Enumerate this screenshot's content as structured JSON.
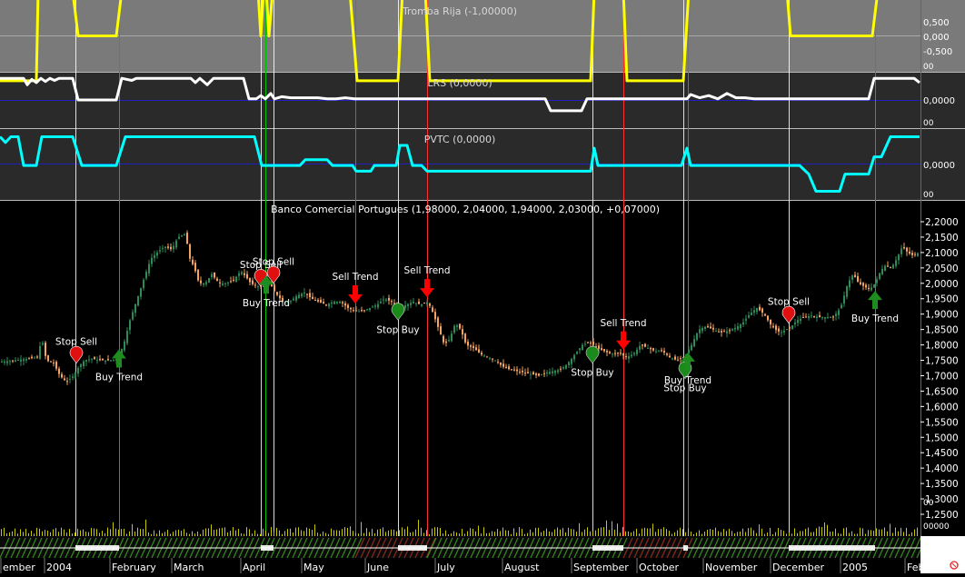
{
  "panels": {
    "tromba": {
      "title": "Tromba Rija (-1,00000)",
      "ticks": [
        "0,500",
        "0,000",
        "-0,500"
      ],
      "corner": "00"
    },
    "lrs": {
      "title": "LRS (0,0000)",
      "ticks": [
        "0,0000"
      ],
      "corner": "00"
    },
    "pvtc": {
      "title": "PVTC (0,0000)",
      "ticks": [
        "0,0000"
      ],
      "corner": "00"
    },
    "price": {
      "title": "Banco Comercial Portugues (1,98000, 2,04000, 1,94000, 2,03000, +0,07000)",
      "corner1": "00",
      "corner2": "00000"
    }
  },
  "colors": {
    "tromba_line": "#ffff00",
    "lrs_line": "#ffffff",
    "pvtc_line": "#00ffff",
    "candle_up": "#2e8b57",
    "candle_down": "#f4a460",
    "buy_arrow": "#1e8c1e",
    "sell_arrow": "#ff0000",
    "buy_line": "#00c000",
    "sell_line": "#ff3030",
    "stop_line": "#ffffff"
  },
  "chart_data": {
    "type": "line",
    "y_axis_ticks": [
      "2,2000",
      "2,1500",
      "2,1000",
      "2,0500",
      "2,0000",
      "1,9500",
      "1,9000",
      "1,8500",
      "1,8000",
      "1,7500",
      "1,7000",
      "1,6500",
      "1,6000",
      "1,5500",
      "1,5000",
      "1,4500",
      "1,4000",
      "1,3500",
      "1,3000",
      "1,2500"
    ],
    "ylim": [
      1.22,
      2.23
    ],
    "x_axis_labels": [
      "ember",
      "2004",
      "February",
      "March",
      "April",
      "May",
      "June",
      "July",
      "August",
      "September",
      "October",
      "November",
      "December",
      "2005",
      "Feb"
    ],
    "price_series": [
      [
        0,
        1.745
      ],
      [
        10,
        1.748
      ],
      [
        20,
        1.752
      ],
      [
        30,
        1.755
      ],
      [
        40,
        1.76
      ],
      [
        45,
        1.82
      ],
      [
        50,
        1.75
      ],
      [
        58,
        1.74
      ],
      [
        65,
        1.7
      ],
      [
        72,
        1.68
      ],
      [
        80,
        1.7
      ],
      [
        86,
        1.73
      ],
      [
        92,
        1.75
      ],
      [
        100,
        1.755
      ],
      [
        110,
        1.75
      ],
      [
        120,
        1.75
      ],
      [
        128,
        1.755
      ],
      [
        135,
        1.8
      ],
      [
        142,
        1.88
      ],
      [
        150,
        1.95
      ],
      [
        158,
        2.02
      ],
      [
        165,
        2.08
      ],
      [
        172,
        2.1
      ],
      [
        180,
        2.12
      ],
      [
        188,
        2.11
      ],
      [
        195,
        2.15
      ],
      [
        203,
        2.16
      ],
      [
        208,
        2.08
      ],
      [
        213,
        2.05
      ],
      [
        218,
        2.0
      ],
      [
        225,
        2.0
      ],
      [
        232,
        2.03
      ],
      [
        240,
        2.0
      ],
      [
        248,
        2.0
      ],
      [
        256,
        2.01
      ],
      [
        264,
        2.04
      ],
      [
        270,
        2.02
      ],
      [
        275,
        2.0
      ],
      [
        282,
        1.99
      ],
      [
        290,
        1.99
      ],
      [
        296,
        2.0
      ],
      [
        302,
        1.97
      ],
      [
        310,
        1.94
      ],
      [
        318,
        1.94
      ],
      [
        326,
        1.96
      ],
      [
        334,
        1.97
      ],
      [
        342,
        1.95
      ],
      [
        350,
        1.94
      ],
      [
        358,
        1.93
      ],
      [
        366,
        1.94
      ],
      [
        374,
        1.94
      ],
      [
        382,
        1.92
      ],
      [
        390,
        1.91
      ],
      [
        398,
        1.91
      ],
      [
        406,
        1.92
      ],
      [
        414,
        1.93
      ],
      [
        422,
        1.95
      ],
      [
        430,
        1.94
      ],
      [
        438,
        1.92
      ],
      [
        446,
        1.93
      ],
      [
        454,
        1.94
      ],
      [
        462,
        1.93
      ],
      [
        470,
        1.94
      ],
      [
        476,
        1.9
      ],
      [
        482,
        1.85
      ],
      [
        488,
        1.8
      ],
      [
        494,
        1.82
      ],
      [
        500,
        1.87
      ],
      [
        506,
        1.85
      ],
      [
        512,
        1.8
      ],
      [
        520,
        1.79
      ],
      [
        528,
        1.77
      ],
      [
        536,
        1.76
      ],
      [
        544,
        1.75
      ],
      [
        552,
        1.73
      ],
      [
        560,
        1.72
      ],
      [
        568,
        1.715
      ],
      [
        576,
        1.71
      ],
      [
        584,
        1.705
      ],
      [
        592,
        1.7
      ],
      [
        600,
        1.71
      ],
      [
        608,
        1.715
      ],
      [
        616,
        1.72
      ],
      [
        624,
        1.74
      ],
      [
        632,
        1.77
      ],
      [
        640,
        1.8
      ],
      [
        648,
        1.81
      ],
      [
        656,
        1.79
      ],
      [
        664,
        1.78
      ],
      [
        672,
        1.77
      ],
      [
        680,
        1.775
      ],
      [
        688,
        1.76
      ],
      [
        696,
        1.77
      ],
      [
        704,
        1.8
      ],
      [
        712,
        1.79
      ],
      [
        720,
        1.78
      ],
      [
        728,
        1.78
      ],
      [
        736,
        1.76
      ],
      [
        744,
        1.75
      ],
      [
        752,
        1.76
      ],
      [
        760,
        1.8
      ],
      [
        768,
        1.85
      ],
      [
        776,
        1.86
      ],
      [
        784,
        1.85
      ],
      [
        792,
        1.84
      ],
      [
        800,
        1.845
      ],
      [
        808,
        1.855
      ],
      [
        816,
        1.87
      ],
      [
        824,
        1.9
      ],
      [
        832,
        1.92
      ],
      [
        840,
        1.9
      ],
      [
        846,
        1.87
      ],
      [
        852,
        1.85
      ],
      [
        858,
        1.84
      ],
      [
        864,
        1.85
      ],
      [
        870,
        1.86
      ],
      [
        876,
        1.88
      ],
      [
        884,
        1.89
      ],
      [
        892,
        1.895
      ],
      [
        900,
        1.89
      ],
      [
        908,
        1.89
      ],
      [
        916,
        1.89
      ],
      [
        924,
        1.92
      ],
      [
        932,
        2.0
      ],
      [
        938,
        2.03
      ],
      [
        944,
        2.0
      ],
      [
        950,
        1.99
      ],
      [
        956,
        1.98
      ],
      [
        962,
        2.0
      ],
      [
        968,
        2.04
      ],
      [
        974,
        2.06
      ],
      [
        980,
        2.05
      ],
      [
        986,
        2.08
      ],
      [
        992,
        2.12
      ],
      [
        998,
        2.1
      ],
      [
        1004,
        2.09
      ],
      [
        1010,
        2.1
      ]
    ],
    "tromba_series": [
      [
        0,
        -1
      ],
      [
        40,
        -1
      ],
      [
        42,
        1
      ],
      [
        80,
        1
      ],
      [
        86,
        0
      ],
      [
        128,
        0
      ],
      [
        134,
        1
      ],
      [
        284,
        1
      ],
      [
        287,
        0
      ],
      [
        290,
        1
      ],
      [
        293,
        1
      ],
      [
        296,
        0
      ],
      [
        300,
        1
      ],
      [
        385,
        1
      ],
      [
        393,
        -1
      ],
      [
        438,
        -1
      ],
      [
        443,
        1
      ],
      [
        468,
        1
      ],
      [
        473,
        -1
      ],
      [
        650,
        -1
      ],
      [
        654,
        1
      ],
      [
        686,
        1
      ],
      [
        690,
        -1
      ],
      [
        752,
        -1
      ],
      [
        758,
        1
      ],
      [
        866,
        1
      ],
      [
        870,
        0
      ],
      [
        960,
        0
      ],
      [
        966,
        1
      ],
      [
        1012,
        1
      ]
    ],
    "tromba_ylim": [
      -0.8,
      0.8
    ],
    "lrs_series": [
      [
        0,
        1
      ],
      [
        26,
        1
      ],
      [
        30,
        0.7
      ],
      [
        35,
        0.95
      ],
      [
        40,
        0.8
      ],
      [
        45,
        1
      ],
      [
        50,
        0.85
      ],
      [
        55,
        1
      ],
      [
        60,
        0.9
      ],
      [
        65,
        1
      ],
      [
        80,
        1
      ],
      [
        86,
        0
      ],
      [
        128,
        0
      ],
      [
        134,
        1
      ],
      [
        145,
        0.9
      ],
      [
        150,
        1
      ],
      [
        210,
        1
      ],
      [
        215,
        0.8
      ],
      [
        220,
        1
      ],
      [
        228,
        0.7
      ],
      [
        235,
        1
      ],
      [
        268,
        1
      ],
      [
        274,
        0.05
      ],
      [
        282,
        0.05
      ],
      [
        287,
        0.2
      ],
      [
        292,
        0.05
      ],
      [
        298,
        0.3
      ],
      [
        302,
        0.05
      ],
      [
        310,
        0.15
      ],
      [
        320,
        0.1
      ],
      [
        330,
        0.1
      ],
      [
        340,
        0.1
      ],
      [
        350,
        0.1
      ],
      [
        360,
        0.05
      ],
      [
        370,
        0.05
      ],
      [
        380,
        0.1
      ],
      [
        390,
        0.05
      ],
      [
        400,
        0.05
      ],
      [
        420,
        0.05
      ],
      [
        440,
        0.05
      ],
      [
        460,
        0.05
      ],
      [
        500,
        0.05
      ],
      [
        600,
        0.05
      ],
      [
        606,
        -0.5
      ],
      [
        640,
        -0.5
      ],
      [
        646,
        0.05
      ],
      [
        700,
        0.05
      ],
      [
        720,
        0.05
      ],
      [
        740,
        0.05
      ],
      [
        756,
        0.05
      ],
      [
        760,
        0.25
      ],
      [
        770,
        0.1
      ],
      [
        780,
        0.2
      ],
      [
        790,
        0.05
      ],
      [
        800,
        0.3
      ],
      [
        810,
        0.1
      ],
      [
        820,
        0.1
      ],
      [
        830,
        0.05
      ],
      [
        900,
        0.05
      ],
      [
        956,
        0.05
      ],
      [
        962,
        1
      ],
      [
        1006,
        1
      ],
      [
        1012,
        0.8
      ]
    ],
    "lrs_ylim": [
      -1.3,
      1.3
    ],
    "pvtc_series": [
      [
        0,
        1
      ],
      [
        6,
        0.8
      ],
      [
        12,
        1
      ],
      [
        20,
        1
      ],
      [
        26,
        0
      ],
      [
        40,
        0
      ],
      [
        46,
        1
      ],
      [
        80,
        1
      ],
      [
        90,
        0
      ],
      [
        128,
        0
      ],
      [
        138,
        1
      ],
      [
        280,
        1
      ],
      [
        288,
        0
      ],
      [
        330,
        0
      ],
      [
        336,
        0.2
      ],
      [
        360,
        0.2
      ],
      [
        366,
        0
      ],
      [
        388,
        0
      ],
      [
        392,
        -0.2
      ],
      [
        408,
        -0.2
      ],
      [
        412,
        0
      ],
      [
        436,
        0
      ],
      [
        440,
        0.7
      ],
      [
        448,
        0.7
      ],
      [
        454,
        0
      ],
      [
        464,
        0
      ],
      [
        470,
        -0.2
      ],
      [
        560,
        -0.2
      ],
      [
        650,
        -0.2
      ],
      [
        654,
        0.6
      ],
      [
        658,
        0
      ],
      [
        750,
        0
      ],
      [
        756,
        0.6
      ],
      [
        760,
        0
      ],
      [
        870,
        0
      ],
      [
        880,
        0
      ],
      [
        890,
        -0.3
      ],
      [
        898,
        -0.9
      ],
      [
        924,
        -0.9
      ],
      [
        930,
        -0.3
      ],
      [
        956,
        -0.3
      ],
      [
        962,
        0.3
      ],
      [
        970,
        0.3
      ],
      [
        980,
        1
      ],
      [
        1012,
        1
      ]
    ],
    "pvtc_ylim": [
      -1.2,
      1.3
    ],
    "vertical_lines": [
      {
        "x": 83,
        "kind": "stop"
      },
      {
        "x": 131,
        "kind": "buy"
      },
      {
        "x": 287,
        "kind": "stop"
      },
      {
        "x": 292,
        "kind": "buy"
      },
      {
        "x": 301,
        "kind": "stop"
      },
      {
        "x": 391,
        "kind": "sell"
      },
      {
        "x": 438,
        "kind": "stop"
      },
      {
        "x": 470,
        "kind": "sell"
      },
      {
        "x": 652,
        "kind": "stop"
      },
      {
        "x": 686,
        "kind": "sell"
      },
      {
        "x": 752,
        "kind": "stop"
      },
      {
        "x": 757,
        "kind": "buy"
      },
      {
        "x": 868,
        "kind": "stop"
      },
      {
        "x": 963,
        "kind": "buy"
      }
    ],
    "signals": [
      {
        "label": "Stop Sell",
        "kind": "stop-sell",
        "x": 84,
        "y": 1.77
      },
      {
        "label": "Buy Trend",
        "kind": "buy",
        "x": 131,
        "y": 1.75
      },
      {
        "label": "Stop Sell",
        "kind": "stop-sell",
        "x": 287,
        "y": 2.02
      },
      {
        "label": "Stop Sell",
        "kind": "stop-sell",
        "x": 301,
        "y": 2.03
      },
      {
        "label": "Buy Trend",
        "kind": "buy",
        "x": 293,
        "y": 1.99
      },
      {
        "label": "Sell Trend",
        "kind": "sell",
        "x": 391,
        "y": 1.97
      },
      {
        "label": "Stop Buy",
        "kind": "stop-buy",
        "x": 438,
        "y": 1.91
      },
      {
        "label": "Sell Trend",
        "kind": "sell",
        "x": 470,
        "y": 1.99
      },
      {
        "label": "Stop Buy",
        "kind": "stop-buy",
        "x": 652,
        "y": 1.77
      },
      {
        "label": "Sell Trend",
        "kind": "sell",
        "x": 686,
        "y": 1.82
      },
      {
        "label": "Stop Buy",
        "kind": "stop-buy",
        "x": 754,
        "y": 1.72
      },
      {
        "label": "Buy Trend",
        "kind": "buy",
        "x": 757,
        "y": 1.74
      },
      {
        "label": "Stop Sell",
        "kind": "stop-sell",
        "x": 868,
        "y": 1.9
      },
      {
        "label": "Buy Trend",
        "kind": "buy",
        "x": 963,
        "y": 1.94
      }
    ]
  }
}
